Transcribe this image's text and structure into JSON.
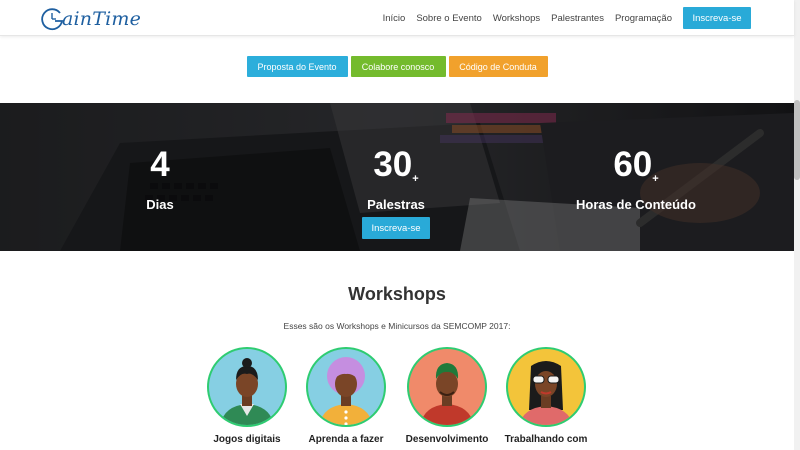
{
  "brand": {
    "name": "GainTime",
    "logo_text": "ainTime"
  },
  "nav": {
    "links": [
      "Início",
      "Sobre o Evento",
      "Workshops",
      "Palestrantes",
      "Programação"
    ],
    "cta": "Inscreva-se"
  },
  "actions": {
    "proposta": "Proposta do Evento",
    "colabore": "Colabore conosco",
    "codigo": "Código de Conduta"
  },
  "stats": {
    "items": [
      {
        "number": "4",
        "plus": "",
        "label": "Dias"
      },
      {
        "number": "30",
        "plus": "+",
        "label": "Palestras"
      },
      {
        "number": "60",
        "plus": "+",
        "label": "Horas de Conteúdo"
      }
    ],
    "cta": "Inscreva-se"
  },
  "workshops": {
    "title": "Workshops",
    "subtitle": "Esses são os Workshops e Minicursos da SEMCOMP 2017:",
    "items": [
      {
        "label": "Jogos digitais",
        "ring": "#2ecc71",
        "bg": "#7ec8e3"
      },
      {
        "label": "Aprenda a fazer",
        "ring": "#2ecc71",
        "bg": "#7ec8e3"
      },
      {
        "label": "Desenvolvimento",
        "ring": "#2ecc71",
        "bg": "#f08a6a"
      },
      {
        "label": "Trabalhando com",
        "ring": "#2ecc71",
        "bg": "#f3c43a"
      }
    ]
  }
}
